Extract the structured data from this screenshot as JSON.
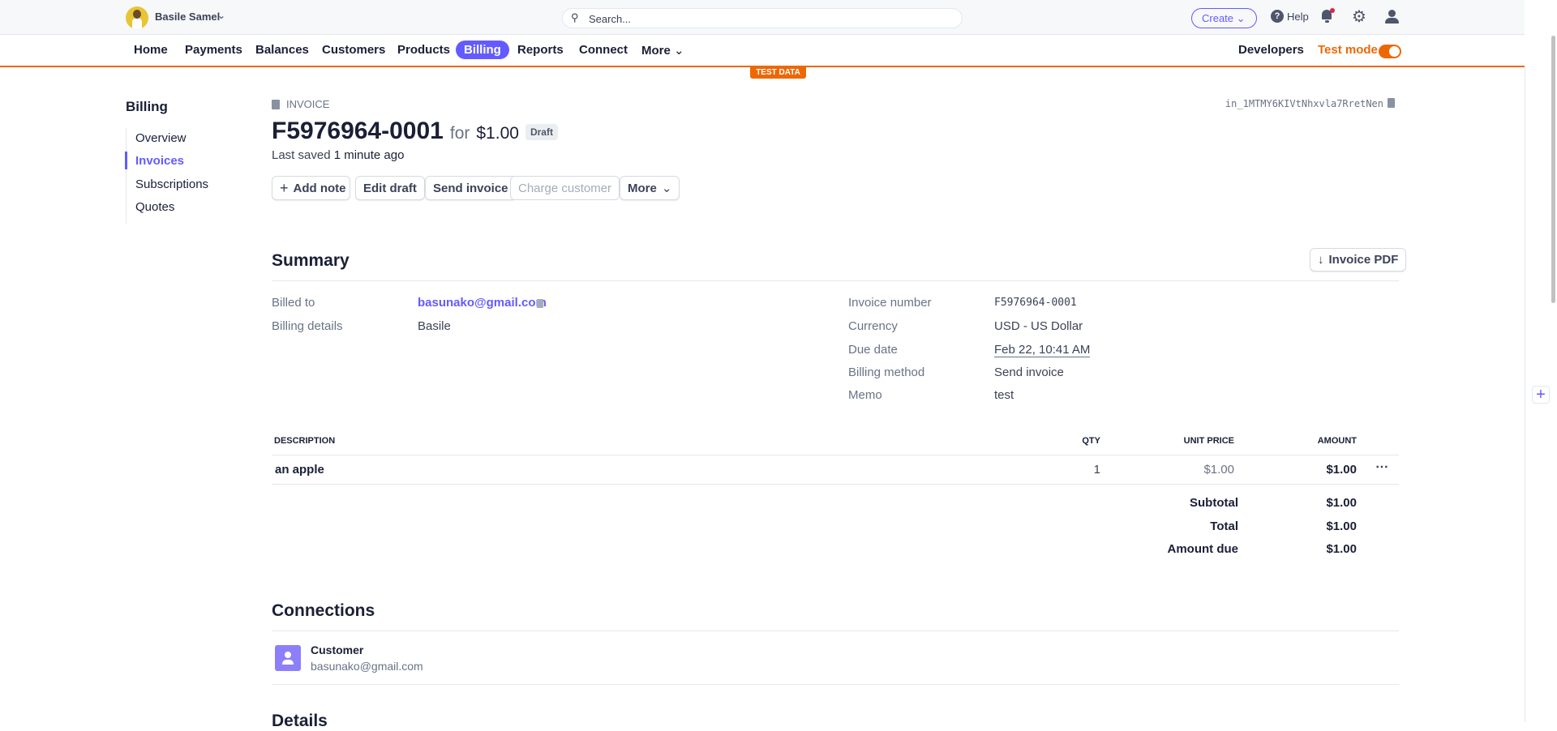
{
  "account": {
    "name": "Basile Samel"
  },
  "search": {
    "placeholder": "Search..."
  },
  "topbar": {
    "create": "Create",
    "help": "Help"
  },
  "nav": {
    "items": [
      "Home",
      "Payments",
      "Balances",
      "Customers",
      "Products",
      "Billing",
      "Reports",
      "Connect",
      "More"
    ],
    "active": "Billing",
    "developers": "Developers",
    "test_mode": "Test mode",
    "test_mode_on": true,
    "test_badge": "TEST DATA"
  },
  "colors": {
    "accent": "#635bff",
    "test": "#ed6804"
  },
  "sidebar": {
    "title": "Billing",
    "items": [
      "Overview",
      "Invoices",
      "Subscriptions",
      "Quotes"
    ],
    "active": "Invoices"
  },
  "invoice": {
    "type_label": "INVOICE",
    "id": "in_1MTMY6KIVtNhxvla7RretNen",
    "number": "F5976964-0001",
    "for": "for",
    "amount": "$1.00",
    "status": "Draft",
    "saved_prefix": "Last saved",
    "saved_time": "1 minute ago",
    "actions": [
      "Add note",
      "Edit draft",
      "Send invoice",
      "Charge customer",
      "More"
    ]
  },
  "summary": {
    "title": "Summary",
    "pdf_button": "Invoice PDF",
    "left": [
      {
        "label": "Billed to",
        "value": "basunako@gmail.com"
      },
      {
        "label": "Billing details",
        "value": "Basile"
      }
    ],
    "right": [
      {
        "label": "Invoice number",
        "value": "F5976964-0001"
      },
      {
        "label": "Currency",
        "value": "USD - US Dollar"
      },
      {
        "label": "Due date",
        "value": "Feb 22, 10:41 AM"
      },
      {
        "label": "Billing method",
        "value": "Send invoice"
      },
      {
        "label": "Memo",
        "value": "test"
      }
    ]
  },
  "items": {
    "headers": [
      "DESCRIPTION",
      "QTY",
      "UNIT PRICE",
      "AMOUNT"
    ],
    "rows": [
      {
        "description": "an apple",
        "qty": "1",
        "unit_price": "$1.00",
        "amount": "$1.00"
      }
    ],
    "totals": [
      {
        "label": "Subtotal",
        "value": "$1.00"
      },
      {
        "label": "Total",
        "value": "$1.00"
      },
      {
        "label": "Amount due",
        "value": "$1.00"
      }
    ]
  },
  "connections": {
    "title": "Connections",
    "customer_label": "Customer",
    "customer_email": "basunako@gmail.com"
  },
  "details": {
    "title": "Details"
  }
}
